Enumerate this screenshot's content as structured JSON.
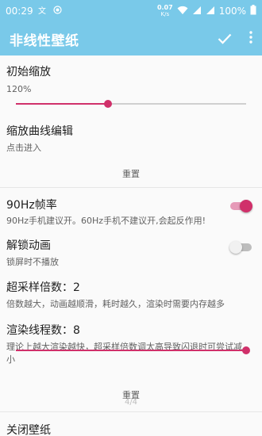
{
  "status_bar": {
    "time": "00:29",
    "speed_value": "0.07",
    "speed_unit": "K/s",
    "battery": "100%"
  },
  "app_bar": {
    "title": "非线性壁纸"
  },
  "settings": {
    "initial_zoom": {
      "title": "初始缩放",
      "value_text": "120%",
      "slider_fraction": 0.4
    },
    "zoom_curve": {
      "title": "缩放曲线编辑",
      "subtitle": "点击进入",
      "reset_label": "重置"
    },
    "refresh_90hz": {
      "title": "90Hz帧率",
      "subtitle": "90Hz手机建议开。60Hz手机不建议开,会起反作用!",
      "enabled": true
    },
    "unlock_animation": {
      "title": "解锁动画",
      "subtitle": "锁屏时不播放",
      "enabled": false
    },
    "supersampling": {
      "title": "超采样倍数：2",
      "subtitle": "倍数越大，动画越顺滑，耗时越久，渲染时需要内存越多"
    },
    "render_threads": {
      "title": "渲染线程数：8",
      "subtitle_line1": "理论上越大渲染越快，超采样倍数调太高导致闪退时可尝试减",
      "subtitle_line2": "小",
      "slider_fraction": 1.0,
      "reset_label": "重置"
    },
    "page_indicator": "4/4",
    "close_wallpaper": {
      "title": "关闭壁纸"
    }
  },
  "colors": {
    "primary": "#79c9e9",
    "accent": "#d0306a"
  }
}
